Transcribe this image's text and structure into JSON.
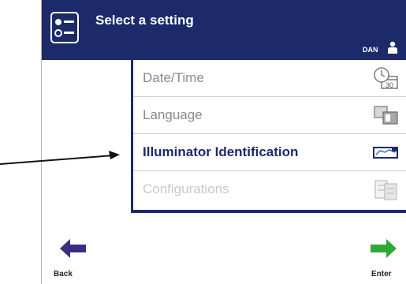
{
  "header": {
    "title": "Select a setting",
    "user": "DAN",
    "icons": {
      "menu": "settings-menu-icon",
      "user": "user-icon"
    }
  },
  "settings_list": {
    "items": [
      {
        "label": "Date/Time",
        "state": "normal",
        "icon": "clock-calendar-icon"
      },
      {
        "label": "Language",
        "state": "normal",
        "icon": "language-icon"
      },
      {
        "label": "Illuminator Identification",
        "state": "selected",
        "icon": "illuminator-icon"
      },
      {
        "label": "Configurations",
        "state": "disabled",
        "icon": "configurations-icon"
      }
    ]
  },
  "footer": {
    "back_label": "Back",
    "enter_label": "Enter"
  },
  "colors": {
    "header_bg": "#1c2a6a",
    "back_arrow": "#3c2d84",
    "enter_arrow": "#2ea836"
  }
}
